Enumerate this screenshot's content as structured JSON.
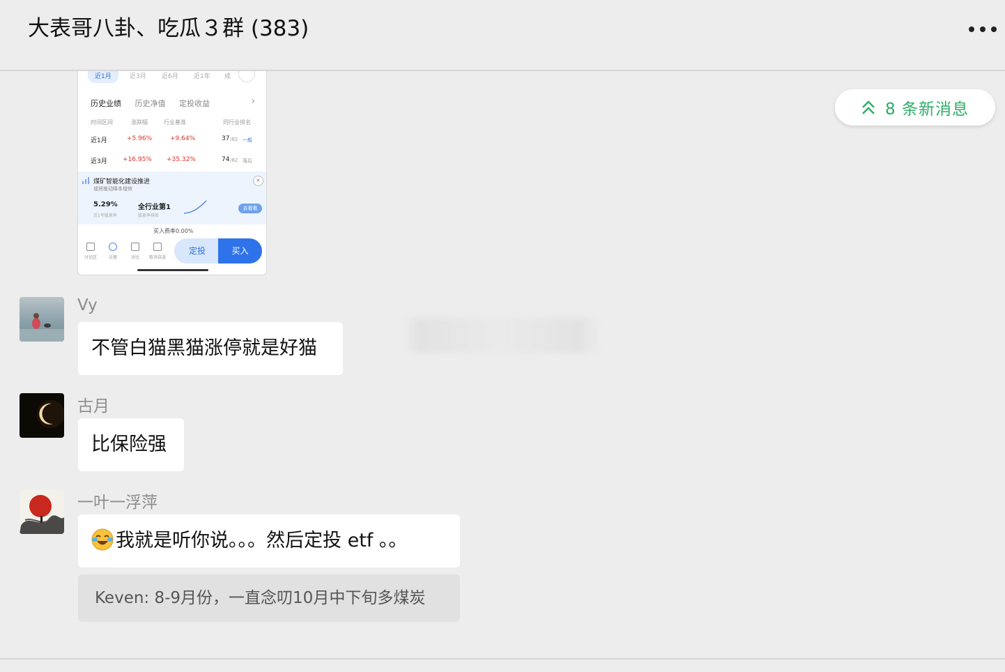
{
  "header": {
    "title": "大表哥八卦、吃瓜３群  (383)"
  },
  "new_messages": {
    "label": "8 条新消息"
  },
  "shared_screenshot": {
    "periods": [
      "近1月",
      "近3月",
      "近6月",
      "近1年",
      "成"
    ],
    "tabs": [
      "历史业绩",
      "历史净值",
      "定投收益"
    ],
    "columns": [
      "时间区间",
      "涨跌幅",
      "行业基准",
      "同行业排名"
    ],
    "rows": [
      {
        "period": "近1月",
        "change": "+5.96%",
        "benchmark": "+9.64%",
        "rank": "37",
        "total": "/82",
        "tag": "一般"
      },
      {
        "period": "近3月",
        "change": "+16.95%",
        "benchmark": "+35.32%",
        "rank": "74",
        "total": "/82",
        "tag": "落后"
      }
    ],
    "promo": {
      "title": "煤矿智能化建设推进",
      "subtitle": "或将推动降本增效",
      "close": "×",
      "value1": "5.29%",
      "label1": "近1年股息率",
      "value2": "全行业第1",
      "label2": "股息率排名",
      "button": "去看看"
    },
    "fee": "买入费率0.00%",
    "bottom_icons": [
      {
        "label": "讨论区",
        "icon": "discussion-icon"
      },
      {
        "label": "诊基",
        "icon": "diagnose-icon"
      },
      {
        "label": "对比",
        "icon": "compare-icon"
      },
      {
        "label": "取消自选",
        "icon": "unfavorite-icon"
      }
    ],
    "plan_button": "定投",
    "buy_button": "买入"
  },
  "messages": [
    {
      "sender": "Vy",
      "text": "不管白猫黑猫涨停就是好猫"
    },
    {
      "sender": "古月",
      "text": "比保险强"
    },
    {
      "sender": "一叶一浮萍",
      "text": "我就是听你说。。。然后定投 etf  。。",
      "emoji": "laughing-crying-emoji"
    }
  ],
  "quote": {
    "text": "Keven: 8-9月份，一直念叨10月中下旬多煤炭"
  },
  "colors": {
    "accent_green": "#2aae67",
    "background": "#ededed",
    "bubble": "#ffffff",
    "red_up": "#e0302a",
    "blue": "#2f73ea"
  }
}
